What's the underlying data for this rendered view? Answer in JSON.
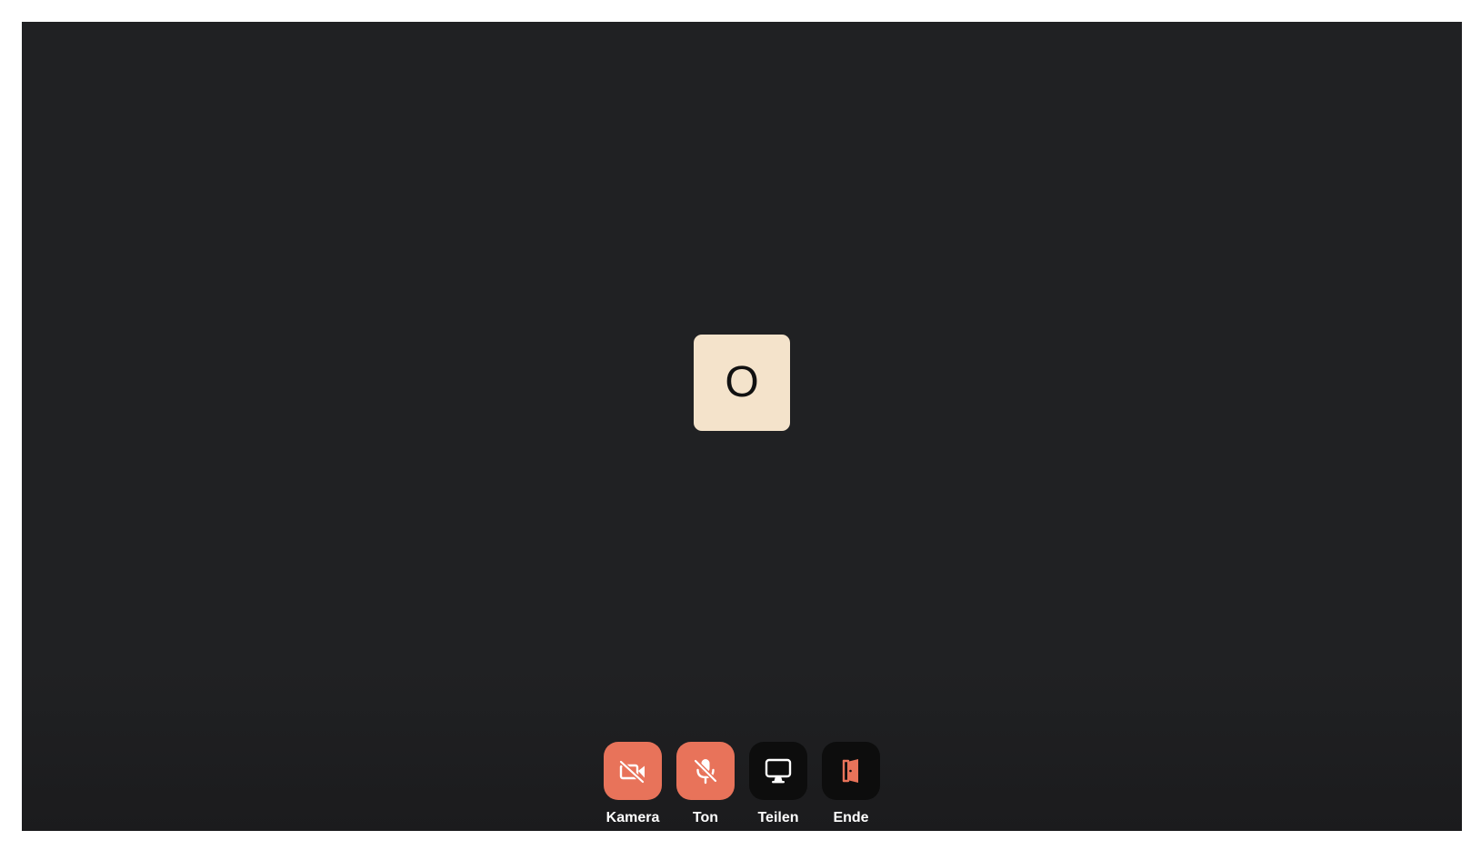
{
  "participant": {
    "initial": "O",
    "tile_color": "#f4e3cb"
  },
  "controls": [
    {
      "id": "camera",
      "label": "Kamera",
      "icon": "camera-off-icon",
      "state": "off",
      "bg": "#e8735a"
    },
    {
      "id": "audio",
      "label": "Ton",
      "icon": "microphone-off-icon",
      "state": "off",
      "bg": "#e8735a"
    },
    {
      "id": "share",
      "label": "Teilen",
      "icon": "monitor-icon",
      "state": "idle",
      "bg": "#0d0d0d"
    },
    {
      "id": "end",
      "label": "Ende",
      "icon": "door-exit-icon",
      "state": "idle",
      "bg": "#0d0d0d"
    }
  ],
  "colors": {
    "background": "#202123",
    "accent": "#e8735a",
    "dark_button": "#0d0d0d"
  }
}
